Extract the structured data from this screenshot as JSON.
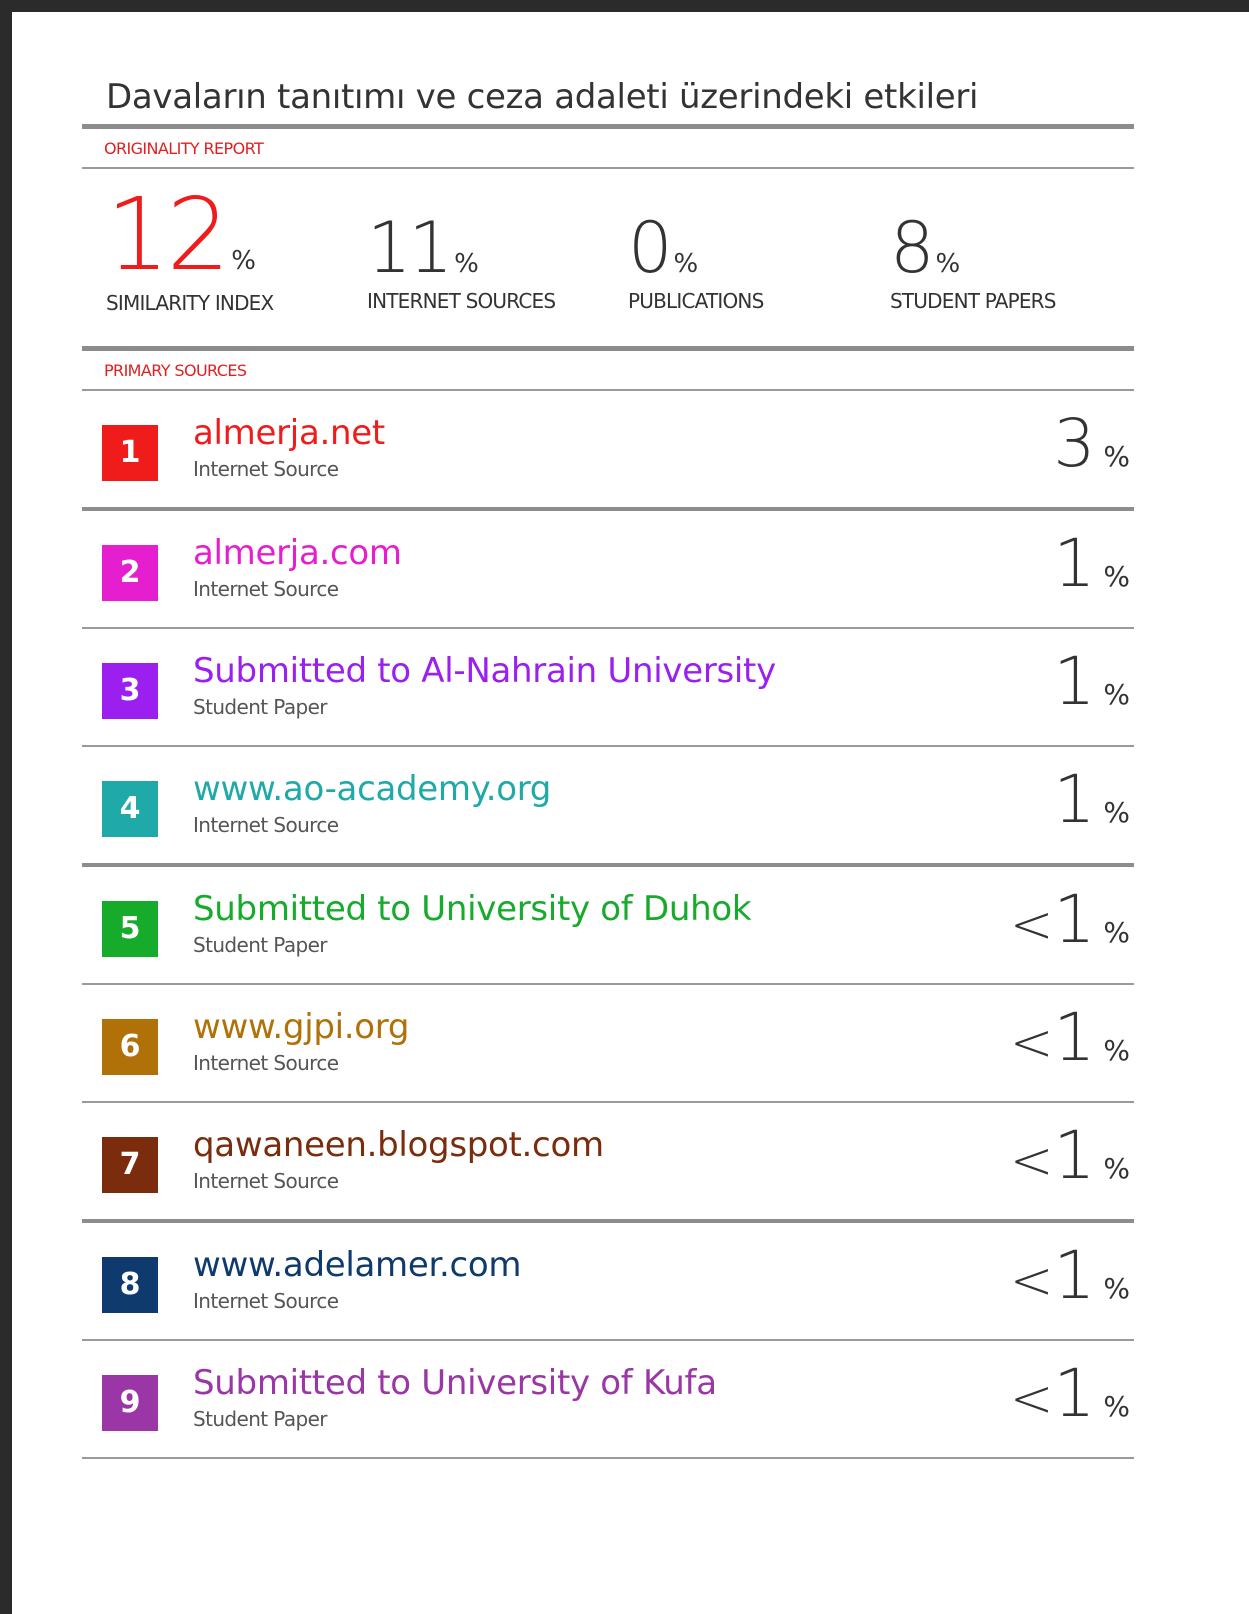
{
  "document": {
    "title": "Davaların tanıtımı ve ceza adaleti üzerindeki etkileri"
  },
  "originality_report": {
    "label": "ORIGINALITY REPORT",
    "percent_sign": "%",
    "stats": [
      {
        "value": "12",
        "label": "SIMILARITY INDEX"
      },
      {
        "value": "11",
        "label": "INTERNET SOURCES"
      },
      {
        "value": "0",
        "label": "PUBLICATIONS"
      },
      {
        "value": "8",
        "label": "STUDENT PAPERS"
      }
    ]
  },
  "primary_sources": {
    "label": "PRIMARY SOURCES",
    "percent_sign": "%",
    "items": [
      {
        "rank": "1",
        "name": "almerja.net",
        "type": "Internet Source",
        "prefix": "",
        "value": "3",
        "color": "#f01c1c"
      },
      {
        "rank": "2",
        "name": "almerja.com",
        "type": "Internet Source",
        "prefix": "",
        "value": "1",
        "color": "#e51fcf"
      },
      {
        "rank": "3",
        "name": "Submitted to Al-Nahrain University",
        "type": "Student Paper",
        "prefix": "",
        "value": "1",
        "color": "#9b1fef"
      },
      {
        "rank": "4",
        "name": "www.ao-academy.org",
        "type": "Internet Source",
        "prefix": "",
        "value": "1",
        "color": "#1fa9a9"
      },
      {
        "rank": "5",
        "name": "Submitted to University of Duhok",
        "type": "Student Paper",
        "prefix": "<",
        "value": "1",
        "color": "#16ab2a"
      },
      {
        "rank": "6",
        "name": "www.gjpi.org",
        "type": "Internet Source",
        "prefix": "<",
        "value": "1",
        "color": "#b07208"
      },
      {
        "rank": "7",
        "name": "qawaneen.blogspot.com",
        "type": "Internet Source",
        "prefix": "<",
        "value": "1",
        "color": "#7b2c0c"
      },
      {
        "rank": "8",
        "name": "www.adelamer.com",
        "type": "Internet Source",
        "prefix": "<",
        "value": "1",
        "color": "#0f3a6e"
      },
      {
        "rank": "9",
        "name": "Submitted to University of Kufa",
        "type": "Student Paper",
        "prefix": "<",
        "value": "1",
        "color": "#9a36a6"
      }
    ]
  }
}
